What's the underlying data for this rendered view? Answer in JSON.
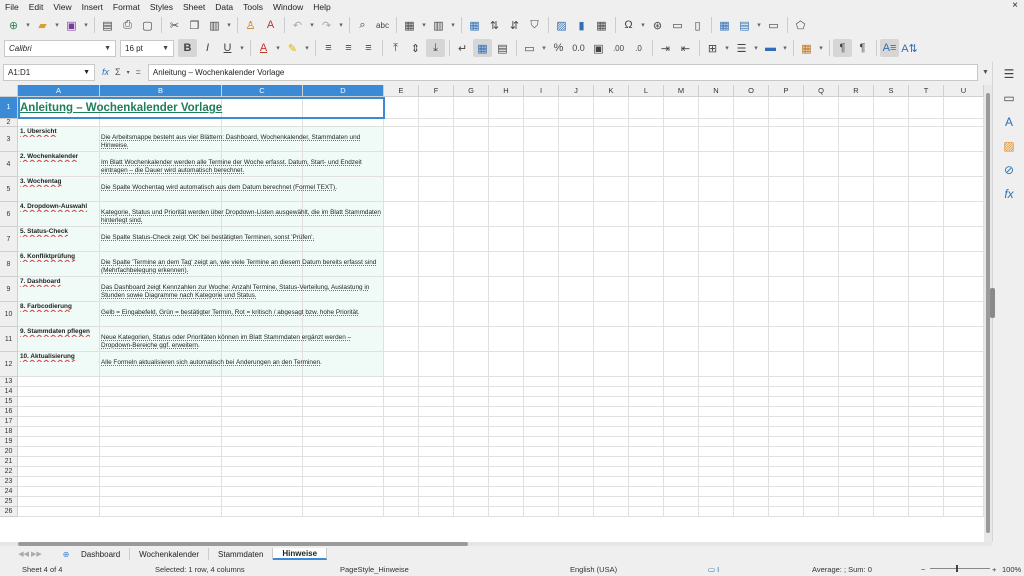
{
  "menu": [
    "File",
    "Edit",
    "View",
    "Insert",
    "Format",
    "Styles",
    "Sheet",
    "Data",
    "Tools",
    "Window",
    "Help"
  ],
  "close_glyph": "×",
  "font": {
    "name": "Calibri",
    "size": "16 pt"
  },
  "name_box": "A1:D1",
  "formula": "Anleitung – Wochenkalender Vorlage",
  "columns": [
    "A",
    "B",
    "C",
    "D",
    "E",
    "F",
    "G",
    "H",
    "I",
    "J",
    "K",
    "L",
    "M",
    "N",
    "O",
    "P",
    "Q",
    "R",
    "S",
    "T",
    "U"
  ],
  "rows": [
    "1",
    "2",
    "3",
    "4",
    "5",
    "6",
    "7",
    "8",
    "9",
    "10",
    "11",
    "12",
    "13",
    "14",
    "15",
    "16",
    "17",
    "18",
    "19",
    "20",
    "21",
    "22",
    "23",
    "24",
    "25",
    "26"
  ],
  "title": "Anleitung – Wochenkalender Vorlage",
  "items": [
    {
      "term": "1. Übersicht",
      "desc": "Die Arbeitsmappe besteht aus vier Blättern: Dashboard, Wochenkalender, Stammdaten und Hinweise."
    },
    {
      "term": "2. Wochenkalender",
      "desc": "Im Blatt Wochenkalender werden alle Termine der Woche erfasst. Datum, Start- und Endzeit eintragen – die Dauer wird automatisch berechnet."
    },
    {
      "term": "3. Wochentag",
      "desc": "Die Spalte Wochentag wird automatisch aus dem Datum berechnet (Formel TEXT)."
    },
    {
      "term": "4. Dropdown-Auswahl",
      "desc": "Kategorie, Status und Priorität werden über Dropdown-Listen ausgewählt, die im Blatt Stammdaten hinterlegt sind."
    },
    {
      "term": "5. Status-Check",
      "desc": "Die Spalte Status-Check zeigt 'OK' bei bestätigten Terminen, sonst 'Prüfen'."
    },
    {
      "term": "6. Konfliktprüfung",
      "desc": "Die Spalte 'Termine an dem Tag' zeigt an, wie viele Termine an diesem Datum bereits erfasst sind (Mehrfachbelegung erkennen)."
    },
    {
      "term": "7. Dashboard",
      "desc": "Das Dashboard zeigt Kennzahlen zur Woche: Anzahl Termine, Status-Verteilung, Auslastung in Stunden sowie Diagramme nach Kategorie und Status."
    },
    {
      "term": "8. Farbcodierung",
      "desc": "Gelb = Eingabefeld, Grün = bestätigter Termin, Rot = kritisch / abgesagt bzw. hohe Priorität."
    },
    {
      "term": "9. Stammdaten pflegen",
      "desc": "Neue Kategorien, Status oder Prioritäten können im Blatt Stammdaten ergänzt werden – Dropdown-Bereiche ggf. erweitern."
    },
    {
      "term": "10. Aktualisierung",
      "desc": "Alle Formeln aktualisieren sich automatisch bei Änderungen an den Terminen."
    }
  ],
  "tabs": [
    "Dashboard",
    "Wochenkalender",
    "Stammdaten",
    "Hinweise"
  ],
  "active_tab": "Hinweise",
  "status": {
    "sheet": "Sheet 4 of 4",
    "selection": "Selected: 1 row, 4 columns",
    "page_style": "PageStyle_Hinweise",
    "language": "English (USA)",
    "sum": "Average: ; Sum: 0",
    "zoom": "100%"
  },
  "colors": {
    "selection": "#3b8ad6",
    "title": "#1e7e5e",
    "band": "#f0fbf8"
  }
}
